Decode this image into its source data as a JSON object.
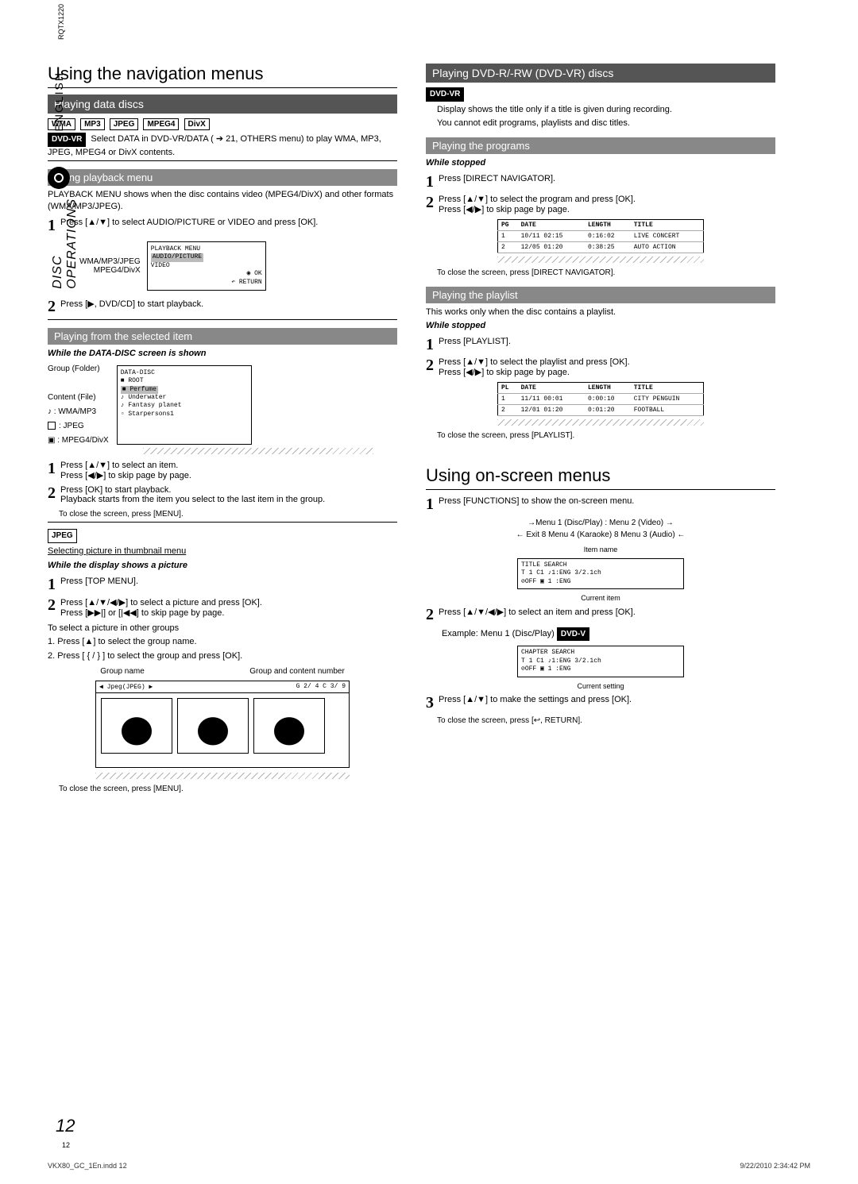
{
  "sidebar": {
    "language": "ENGLISH",
    "section": "DISC OPERATIONS",
    "doc_code": "RQTX1220"
  },
  "page": {
    "big_num": "12",
    "small_num": "12"
  },
  "left": {
    "h1": "Using the navigation menus",
    "s1": {
      "title": "Playing data discs",
      "tags": [
        "WMA",
        "MP3",
        "JPEG",
        "MPEG4",
        "DivX"
      ],
      "dvdvr_tag": "DVD-VR",
      "dvdvr_text": "Select DATA in DVD-VR/DATA ( ➔ 21, OTHERS menu) to play WMA, MP3, JPEG, MPEG4 or DivX contents."
    },
    "s2": {
      "title": "Using playback menu",
      "intro": "PLAYBACK MENU shows when the disc contains video (MPEG4/DivX) and other formats (WMA/MP3/JPEG).",
      "step1": "Press [▲/▼] to select AUDIO/PICTURE or VIDEO and press [OK].",
      "labels_left1": "WMA/MP3/JPEG",
      "labels_left2": "MPEG4/DivX",
      "osd_title": "PLAYBACK MENU",
      "osd_row1": "AUDIO/PICTURE",
      "osd_row2": "VIDEO",
      "osd_ok": "OK",
      "osd_return": "RETURN",
      "step2": "Press [▶, DVD/CD] to start playback."
    },
    "s3": {
      "title": "Playing from the selected item",
      "cond": "While the DATA-DISC screen is shown",
      "grp_label": "Group (Folder)",
      "cnt_label": "Content (File)",
      "legend1": ": WMA/MP3",
      "legend2": ": JPEG",
      "legend3": ": MPEG4/DivX",
      "osd_title": "DATA-DISC",
      "osd_items": [
        "ROOT",
        "Perfume",
        "Underwater",
        "Fantasy planet",
        "Starpersons1"
      ],
      "step1a": "Press [▲/▼] to select an item.",
      "step1b": "Press [◀/▶] to skip page by page.",
      "step2a": "Press [OK] to start playback.",
      "step2b": "Playback starts from the item you select to the last item in the group.",
      "close": "To close the screen, press [MENU]."
    },
    "s4": {
      "tag": "JPEG",
      "subtitle": "Selecting picture in thumbnail menu",
      "cond": "While the display shows a picture",
      "step1": "Press [TOP MENU].",
      "step2a": "Press [▲/▼/◀/▶] to select a picture and press [OK].",
      "step2b": "Press [▶▶|] or [|◀◀] to skip page by page.",
      "other_title": "To select a picture in other groups",
      "other1": "1. Press [▲] to select the group name.",
      "other2": "2. Press [ { / } ] to select the group and press [OK].",
      "fig_l1": "Group name",
      "fig_l2": "Group and content number",
      "fig_hdr_l": "◀ Jpeg(JPEG) ▶",
      "fig_hdr_r": "G   2/   4 C   3/   9",
      "close": "To close the screen, press [MENU]."
    }
  },
  "right": {
    "s1": {
      "title": "Playing DVD-R/-RW (DVD-VR) discs",
      "tag": "DVD-VR",
      "note1": "Display shows the title only if a title is given during recording.",
      "note2": "You cannot edit programs, playlists and disc titles."
    },
    "s2": {
      "title": "Playing the programs",
      "cond": "While stopped",
      "step1": "Press [DIRECT NAVIGATOR].",
      "step2a": "Press [▲/▼] to select the program and press [OK].",
      "step2b": "Press [◀/▶] to skip page by page.",
      "th": [
        "PG",
        "DATE",
        "LENGTH",
        "TITLE"
      ],
      "rows": [
        {
          "pg": "1",
          "date": "10/11 02:15",
          "len": "0:16:02",
          "title": "LIVE CONCERT"
        },
        {
          "pg": "2",
          "date": "12/05 01:20",
          "len": "0:38:25",
          "title": "AUTO ACTION"
        }
      ],
      "close": "To close the screen, press [DIRECT NAVIGATOR]."
    },
    "s3": {
      "title": "Playing the playlist",
      "intro": "This works only when the disc contains a playlist.",
      "cond": "While stopped",
      "step1": "Press [PLAYLIST].",
      "step2a": "Press [▲/▼] to select the playlist and press [OK].",
      "step2b": "Press [◀/▶] to skip page by page.",
      "th": [
        "PL",
        "DATE",
        "LENGTH",
        "TITLE"
      ],
      "rows": [
        {
          "pl": "1",
          "date": "11/11 00:01",
          "len": "0:00:10",
          "title": "CITY PENGUIN"
        },
        {
          "pl": "2",
          "date": "12/01 01:20",
          "len": "0:01:20",
          "title": "FOOTBALL"
        }
      ],
      "close": "To close the screen, press [PLAYLIST]."
    },
    "h2": "Using on-screen menus",
    "s4": {
      "step1": "Press [FUNCTIONS] to show the on-screen menu.",
      "flow1": "→Menu 1 (Disc/Play)   :   Menu 2 (Video)  →",
      "flow2": "← Exit  8  Menu 4 (Karaoke)   8  Menu 3 (Audio) ←",
      "lbl_item": "Item name",
      "box1_l1": "TITLE  SEARCH",
      "box1_l2": "T 1  C1   ♪1:ENG   3/2.1ch",
      "box1_l3": "⊘OFF              ▣  1 :ENG",
      "lbl_cur": "Current item",
      "step2": "Press [▲/▼/◀/▶] to select an item and press [OK].",
      "example_prefix": "Example: Menu 1 (Disc/Play)",
      "example_tag": "DVD-V",
      "box2_l1": "CHAPTER  SEARCH",
      "box2_l2": "T 1  C1   ♪1:ENG   3/2.1ch",
      "box2_l3": "⊘OFF              ▣  1 :ENG",
      "lbl_set": "Current setting",
      "step3": "Press [▲/▼] to make the settings and press [OK].",
      "close": "To close the screen, press [↩, RETURN]."
    }
  },
  "footer": {
    "left": "VKX80_GC_1En.indd   12",
    "right": "9/22/2010   2:34:42 PM"
  }
}
